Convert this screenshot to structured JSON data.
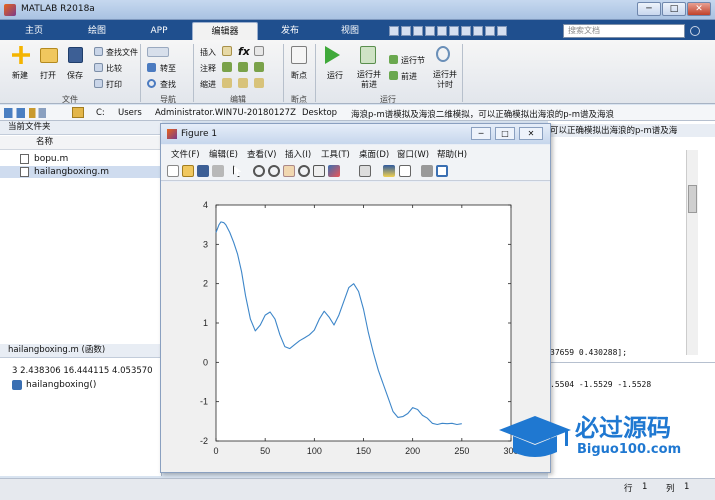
{
  "window": {
    "title": "MATLAB R2018a",
    "min": "─",
    "max": "□",
    "close": "✕"
  },
  "tabs": [
    "主页",
    "绘图",
    "APP",
    "编辑器",
    "发布",
    "视图"
  ],
  "search": {
    "placeholder": "搜索文档"
  },
  "ribbon": {
    "file": {
      "new": "新建",
      "open": "打开",
      "save": "保存",
      "find_files": "查找文件",
      "compare": "比较",
      "print": "打印",
      "group": "文件"
    },
    "nav": {
      "goto": "转至",
      "find": "查找",
      "group": "导航"
    },
    "edit": {
      "insert": "插入",
      "comment": "注释",
      "indent": "缩进",
      "fx": "fx",
      "group": "编辑"
    },
    "breakpoint": {
      "label": "断点",
      "group": "断点"
    },
    "run": {
      "run": "运行",
      "run_advance": "运行并\n前进",
      "run_section": "运行节",
      "advance": "前进",
      "run_time": "运行并\n计时",
      "group": "运行"
    }
  },
  "address": [
    "C:",
    "Users",
    "Administrator.WIN7U-20180127Z",
    "Desktop",
    "海浪p-m谱模拟及海浪二维模拟，可以正确模拟出海浪的p-m谱及海浪"
  ],
  "current_folder": {
    "title": "当前文件夹",
    "col_name": "名称",
    "files": [
      "bopu.m",
      "hailangboxing.m"
    ]
  },
  "details": {
    "title": "hailangboxing.m  (函数)",
    "line1": "3 2.438306 16.444115 4.053570",
    "func": "hailangboxing()"
  },
  "right_panel": {
    "header_tail": "可以正确模拟出海浪的p-m谱及海",
    "text1": "37659 0.430288];",
    "text2": ".5504   -1.5529   -1.5528"
  },
  "status": {
    "row_label": "行",
    "row": "1",
    "col_label": "列",
    "col": "1"
  },
  "figure": {
    "title": "Figure 1",
    "menus": [
      "文件(F)",
      "编辑(E)",
      "查看(V)",
      "插入(I)",
      "工具(T)",
      "桌面(D)",
      "窗口(W)",
      "帮助(H)"
    ]
  },
  "logo": {
    "main": "必过源码",
    "sub": "Biguo100.com"
  },
  "chart_data": {
    "type": "line",
    "xlim": [
      0,
      300
    ],
    "ylim": [
      -2,
      4
    ],
    "xticks": [
      0,
      50,
      100,
      150,
      200,
      250,
      300
    ],
    "yticks": [
      -2,
      -1,
      0,
      1,
      2,
      3,
      4
    ],
    "series": [
      {
        "color": "#3d86c9",
        "x": [
          0,
          3,
          5,
          8,
          10,
          14,
          18,
          22,
          26,
          30,
          35,
          40,
          45,
          50,
          55,
          60,
          65,
          70,
          75,
          80,
          85,
          90,
          95,
          100,
          105,
          110,
          115,
          120,
          125,
          130,
          135,
          140,
          145,
          150,
          155,
          160,
          165,
          170,
          175,
          180,
          185,
          190,
          195,
          200,
          205,
          210,
          215,
          220,
          225,
          230,
          235,
          240,
          245,
          250
        ],
        "y": [
          3.3,
          3.5,
          3.57,
          3.55,
          3.5,
          3.3,
          3.05,
          2.75,
          2.3,
          1.7,
          1.1,
          0.8,
          0.95,
          1.2,
          1.28,
          1.1,
          0.7,
          0.4,
          0.35,
          0.45,
          0.55,
          0.62,
          0.7,
          0.82,
          1.1,
          1.3,
          1.15,
          0.95,
          1.2,
          1.55,
          1.9,
          2.0,
          1.8,
          1.35,
          0.75,
          0.25,
          -0.2,
          -0.55,
          -0.9,
          -1.25,
          -1.4,
          -1.38,
          -1.3,
          -1.15,
          -1.2,
          -1.35,
          -1.42,
          -1.55,
          -1.58,
          -1.55,
          -1.56,
          -1.55,
          -1.58,
          -1.56
        ]
      }
    ]
  }
}
